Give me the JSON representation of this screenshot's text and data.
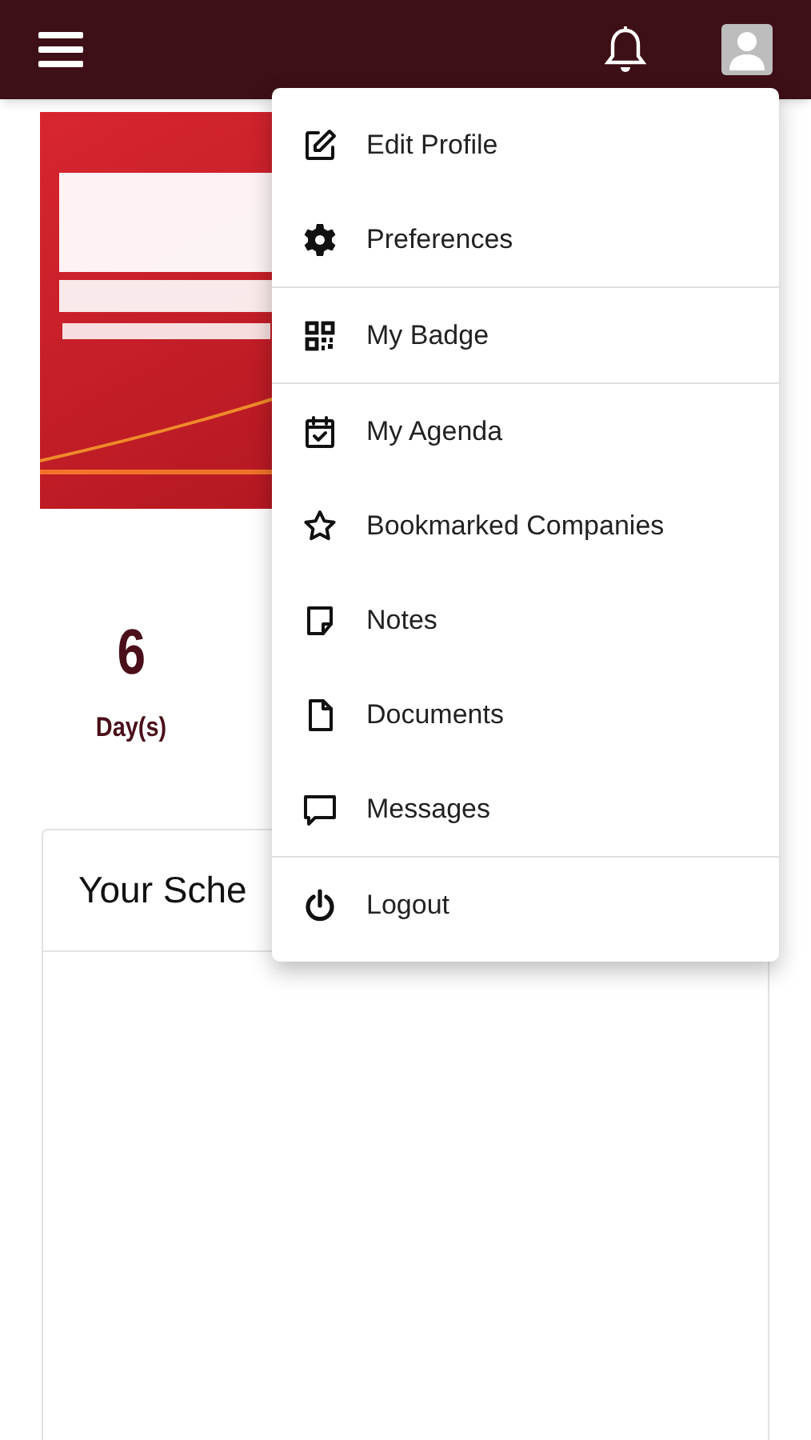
{
  "countdown": [
    {
      "value": "6",
      "unit": "Day(s)"
    }
  ],
  "schedule_card": {
    "title": "Your Sche"
  },
  "menu": {
    "sections": [
      [
        {
          "label": "Edit Profile"
        },
        {
          "label": "Preferences"
        }
      ],
      [
        {
          "label": "My Badge"
        }
      ],
      [
        {
          "label": "My Agenda"
        },
        {
          "label": "Bookmarked Companies"
        },
        {
          "label": "Notes"
        },
        {
          "label": "Documents"
        },
        {
          "label": "Messages"
        }
      ],
      [
        {
          "label": "Logout"
        }
      ]
    ]
  }
}
